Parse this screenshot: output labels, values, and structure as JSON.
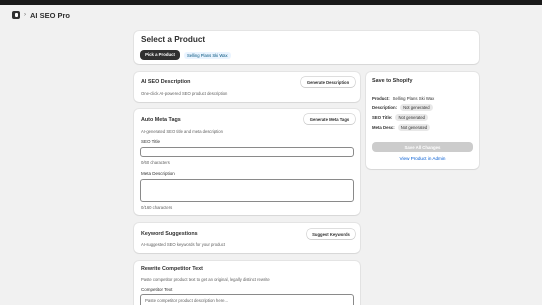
{
  "app": {
    "title": "AI SEO Pro"
  },
  "product_select": {
    "title": "Select a Product",
    "pick_label": "Pick a Product",
    "selected_product": "Selling Plans Ski Wax"
  },
  "ai_description": {
    "title": "AI SEO Description",
    "subtitle": "One-click AI-powered SEO product description",
    "button_label": "Generate Description"
  },
  "meta_tags": {
    "title": "Auto Meta Tags",
    "subtitle": "AI-generated SEO title and meta description",
    "button_label": "Generate Meta Tags",
    "seo_title_label": "SEO Title",
    "seo_title_value": "",
    "seo_title_counter": "0/60 characters",
    "meta_desc_label": "Meta Description",
    "meta_desc_value": "",
    "meta_desc_counter": "0/160 characters"
  },
  "keywords": {
    "title": "Keyword Suggestions",
    "subtitle": "AI-suggested SEO keywords for your product",
    "button_label": "Suggest Keywords"
  },
  "competitor": {
    "title": "Rewrite Competitor Text",
    "subtitle": "Paste competitor product text to get an original, legally distinct rewrite",
    "field_label": "Competitor Text",
    "placeholder": "Paste competitor product description here..."
  },
  "shopify": {
    "title": "Save to Shopify",
    "product_key": "Product:",
    "product_value": "Selling Plans Ski Wax",
    "description_key": "Description:",
    "description_status": "Not generated",
    "seo_title_key": "SEO Title:",
    "seo_title_status": "Not generated",
    "meta_desc_key": "Meta Desc:",
    "meta_desc_status": "Not generated",
    "save_button_label": "Save All Changes",
    "view_admin_label": "View Product in Admin"
  },
  "colors": {
    "page_bg": "#f1f1f1",
    "primary_button": "#303030",
    "disabled_button": "#cccccc",
    "link": "#005bd3",
    "selected_badge_bg": "#eaf4ff",
    "selected_badge_text": "#00527c"
  }
}
